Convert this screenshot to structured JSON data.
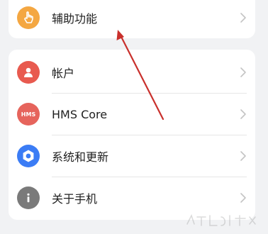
{
  "colors": {
    "background": "#f1f2f4",
    "card": "#ffffff",
    "accessibility_icon_bg": "#f4a742",
    "account_icon_bg": "#e85a4f",
    "hms_icon_bg": "#e6645c",
    "system_icon_bg": "#3b7cf5",
    "about_icon_bg": "#7a7a7a",
    "annotation_arrow": "#c9302c"
  },
  "settings": {
    "accessibility": {
      "label": "辅助功能",
      "icon": "hand-icon"
    },
    "items": [
      {
        "label": "帐户",
        "icon": "person-icon"
      },
      {
        "label": "HMS Core",
        "icon": "hms-logo-icon",
        "icon_text": "HMS"
      },
      {
        "label": "系统和更新",
        "icon": "gear-icon"
      },
      {
        "label": "关于手机",
        "icon": "info-icon"
      }
    ]
  }
}
